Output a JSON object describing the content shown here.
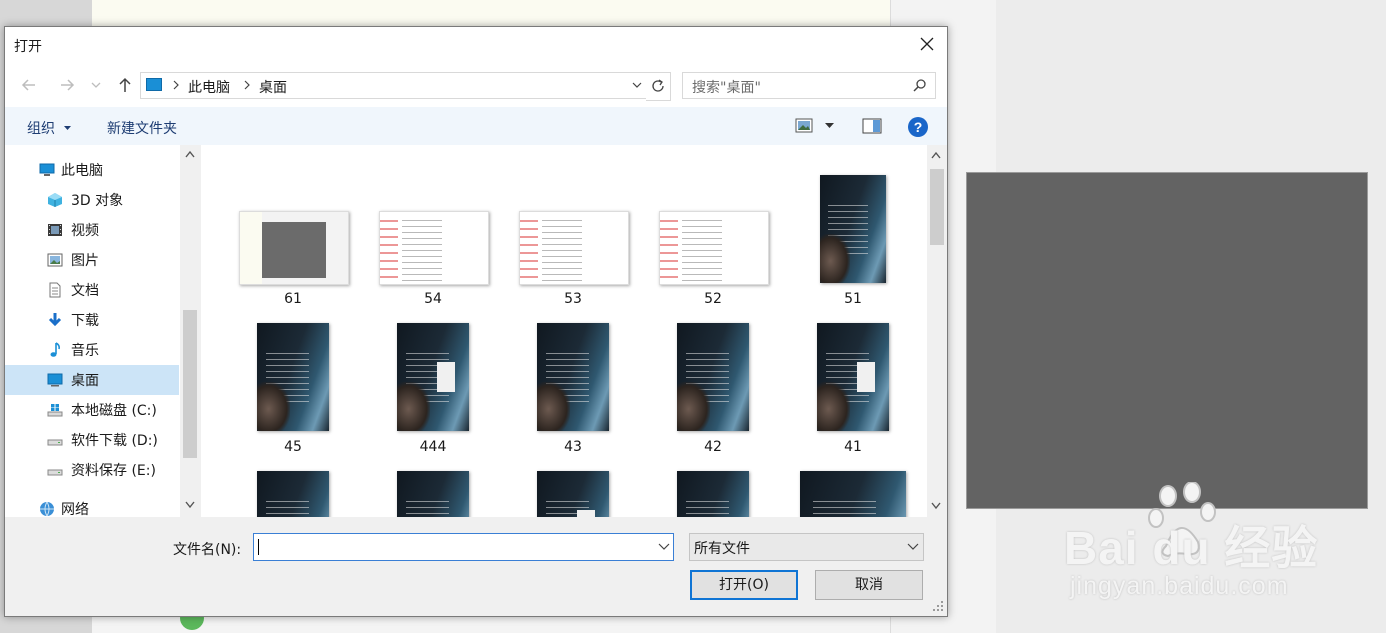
{
  "dialog": {
    "title": "打开"
  },
  "nav": {
    "breadcrumb": [
      "此电脑",
      "桌面"
    ],
    "search_placeholder": "搜索\"桌面\""
  },
  "toolbar": {
    "organize": "组织",
    "new_folder": "新建文件夹"
  },
  "sidebar": {
    "items": [
      {
        "label": "此电脑",
        "icon": "computer-icon"
      },
      {
        "label": "3D 对象",
        "icon": "3d-objects-icon"
      },
      {
        "label": "视频",
        "icon": "video-icon"
      },
      {
        "label": "图片",
        "icon": "pictures-icon"
      },
      {
        "label": "文档",
        "icon": "documents-icon"
      },
      {
        "label": "下载",
        "icon": "download-icon"
      },
      {
        "label": "音乐",
        "icon": "music-icon"
      },
      {
        "label": "桌面",
        "icon": "desktop-icon",
        "selected": true
      },
      {
        "label": "本地磁盘 (C:)",
        "icon": "windows-drive-icon"
      },
      {
        "label": "软件下载 (D:)",
        "icon": "drive-icon"
      },
      {
        "label": "资料保存 (E:)",
        "icon": "drive-icon"
      },
      {
        "label": "网络",
        "icon": "network-icon"
      }
    ]
  },
  "files": [
    {
      "name": "61",
      "kind": "light"
    },
    {
      "name": "54",
      "kind": "screenshot"
    },
    {
      "name": "53",
      "kind": "screenshot"
    },
    {
      "name": "52",
      "kind": "screenshot"
    },
    {
      "name": "51",
      "kind": "dark"
    },
    {
      "name": "45",
      "kind": "dark"
    },
    {
      "name": "444",
      "kind": "dark"
    },
    {
      "name": "43",
      "kind": "dark"
    },
    {
      "name": "42",
      "kind": "dark"
    },
    {
      "name": "41",
      "kind": "dark"
    },
    {
      "name": "",
      "kind": "dark"
    },
    {
      "name": "",
      "kind": "dark"
    },
    {
      "name": "",
      "kind": "dark"
    },
    {
      "name": "",
      "kind": "dark"
    },
    {
      "name": "",
      "kind": "dark"
    }
  ],
  "footer": {
    "filename_label": "文件名(N):",
    "filename_value": "",
    "filetype": "所有文件",
    "open_button": "打开(O)",
    "cancel_button": "取消"
  },
  "watermark": {
    "brand": "Bai du 经验",
    "url": "jingyan.baidu.com"
  },
  "colors": {
    "accent": "#0f74d4",
    "selection": "#cce4f7",
    "preview_gray": "#636363"
  }
}
